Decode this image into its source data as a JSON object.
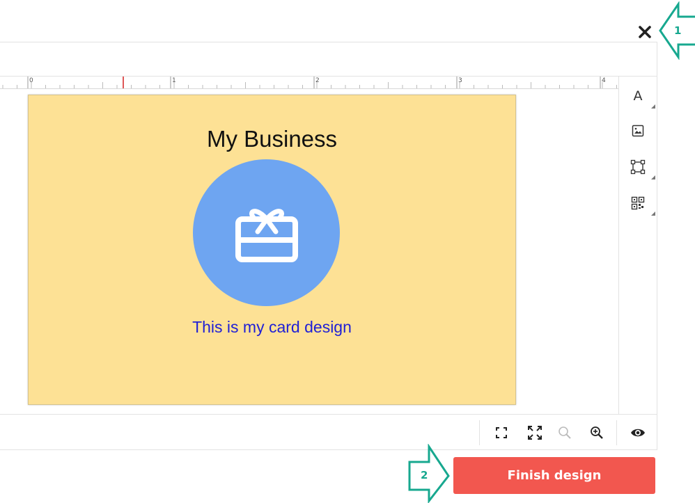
{
  "dialog": {
    "close_icon": "close-icon"
  },
  "ruler": {
    "labels": [
      "0",
      "1",
      "2",
      "3",
      "4"
    ]
  },
  "card": {
    "title": "My Business",
    "subtitle": "This is my card design",
    "image_icon": "gift-card-icon",
    "background_color": "#fde195",
    "circle_color": "#6ea5f1",
    "subtitle_color": "#1f1fd6"
  },
  "toolbar": {
    "tools": [
      {
        "name": "text-tool",
        "label": "A"
      },
      {
        "name": "image-tool",
        "icon": "image-icon"
      },
      {
        "name": "shape-tool",
        "icon": "shape-frame-icon"
      },
      {
        "name": "qr-code-tool",
        "icon": "qr-code-icon"
      }
    ]
  },
  "bottom_controls": {
    "buttons": [
      "fit-to-screen-icon",
      "fullscreen-icon",
      "zoom-out-icon",
      "zoom-in-icon",
      "preview-eye-icon"
    ]
  },
  "actions": {
    "finish_label": "Finish design",
    "finish_color": "#f2574f"
  },
  "callouts": [
    {
      "number": "1",
      "points_to": "close-button"
    },
    {
      "number": "2",
      "points_to": "finish-design-button"
    }
  ],
  "callout_color": "#17a88f"
}
